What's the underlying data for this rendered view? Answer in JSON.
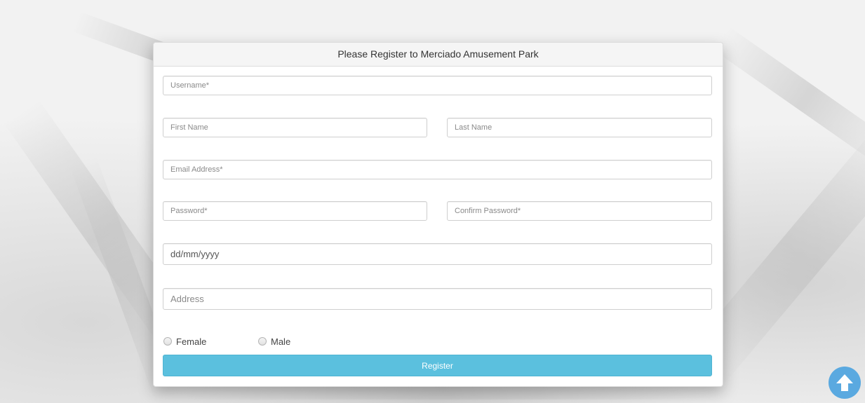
{
  "form": {
    "title": "Please Register to Merciado Amusement Park",
    "fields": {
      "username_placeholder": "Username*",
      "first_name_placeholder": "First Name",
      "last_name_placeholder": "Last Name",
      "email_placeholder": "Email Address*",
      "password_placeholder": "Password*",
      "confirm_password_placeholder": "Confirm Password*",
      "dob_value": "dd/mm/yyyy",
      "address_placeholder": "Address"
    },
    "gender": {
      "female_label": "Female",
      "male_label": "Male"
    },
    "register_label": "Register"
  },
  "icons": {
    "scroll_top": "arrow-up-icon"
  },
  "colors": {
    "register_button": "#5bc0de",
    "scroll_top_button": "#5aa9e0"
  }
}
